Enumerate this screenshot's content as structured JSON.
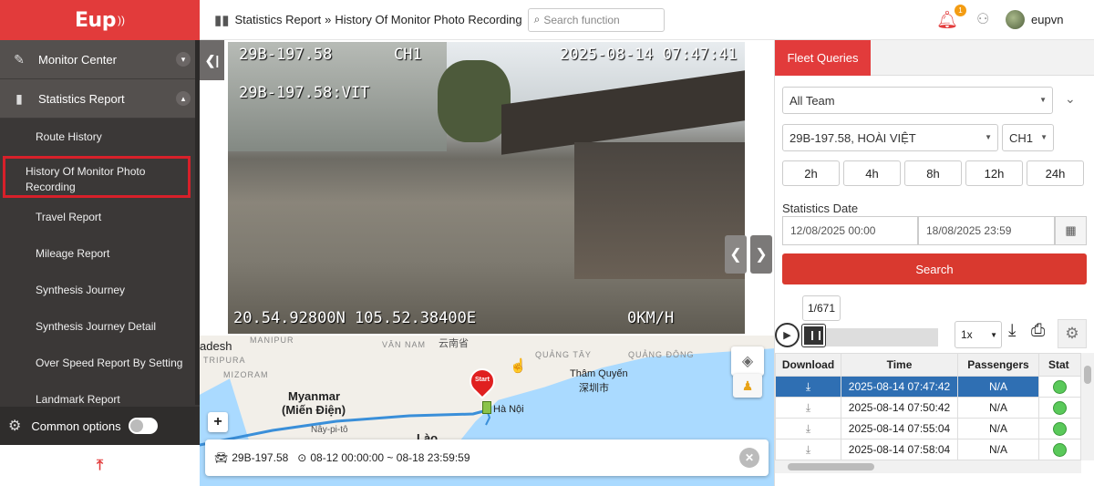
{
  "brand": {
    "logo_text": "Eup"
  },
  "sidebar": {
    "menus": [
      {
        "label": "Monitor Center",
        "icon": "map-marker-icon",
        "expanded": false
      },
      {
        "label": "Statistics Report",
        "icon": "bar-chart-icon",
        "expanded": true
      }
    ],
    "items": [
      {
        "label": "Route History"
      },
      {
        "label": "History Of Monitor Photo Recording",
        "active": true
      },
      {
        "label": "Travel Report"
      },
      {
        "label": "Mileage Report"
      },
      {
        "label": "Synthesis Journey"
      },
      {
        "label": "Synthesis Journey Detail"
      },
      {
        "label": "Over Speed Report By Setting"
      },
      {
        "label": "Landmark Report"
      }
    ],
    "common_options": "Common options"
  },
  "header": {
    "crumb_parent": "Statistics Report",
    "crumb_separator": "»",
    "crumb_current": "History Of Monitor Photo Recording",
    "search_placeholder": "Search function",
    "notification_count": "1",
    "username": "eupvn"
  },
  "video": {
    "plate_top": "29B-197.58",
    "channel": "CH1",
    "timestamp": "2025-08-14 07:47:41",
    "plate_second": "29B-197.58:VIT",
    "coords": "20.54.92800N 105.52.38400E",
    "speed": "0KM/H"
  },
  "map": {
    "labels": {
      "adesh": "adesh",
      "manipur": "MANIPUR",
      "van_nam": "VÂN NAM",
      "van_nam_cn": "云南省",
      "quang_tay": "QUẢNG TÂY",
      "quang_dong": "QUẢNG ĐÔNG",
      "tripura": "TRIPURA",
      "mizoram": "MIZORAM",
      "myanmar": "Myanmar",
      "myanmar_sub": "(Miến Điện)",
      "naypyidaw": "Nây-pi-tô",
      "tham_quyen": "Thâm Quyến",
      "tham_quyen_cn": "深圳市",
      "ha_noi": "Hà Nội",
      "lao": "Lào",
      "start": "Start"
    },
    "zoom_plus": "+",
    "info_plate": "29B-197.58",
    "info_range": "08-12 00:00:00 ~ 08-18 23:59:59"
  },
  "panel": {
    "tab": "Fleet Queries",
    "team": "All Team",
    "vehicle": "29B-197.58, HOÀI VIỆT",
    "channel": "CH1",
    "hours": [
      "2h",
      "4h",
      "8h",
      "12h",
      "24h"
    ],
    "stats_date_label": "Statistics Date",
    "date_from": "12/08/2025 00:00",
    "date_to": "18/08/2025 23:59",
    "search_label": "Search",
    "counter": "1/671",
    "speed": "1x",
    "progress": 0.0
  },
  "table": {
    "headers": [
      "Download",
      "Time",
      "Passengers",
      "Stat"
    ],
    "rows": [
      {
        "time": "2025-08-14 07:47:42",
        "passengers": "N/A",
        "selected": true
      },
      {
        "time": "2025-08-14 07:50:42",
        "passengers": "N/A",
        "selected": false
      },
      {
        "time": "2025-08-14 07:55:04",
        "passengers": "N/A",
        "selected": false
      },
      {
        "time": "2025-08-14 07:58:04",
        "passengers": "N/A",
        "selected": false
      }
    ]
  },
  "colors": {
    "brand_red": "#e23b3b",
    "sidebar_bg": "#3b3837",
    "selected_row": "#2f6fb3",
    "status_ok": "#5ac95a"
  }
}
